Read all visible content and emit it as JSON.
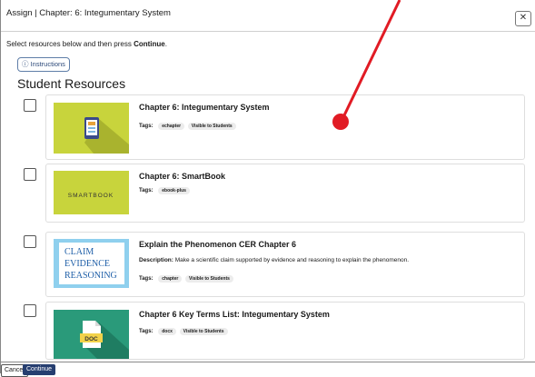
{
  "dialog": {
    "title": "Assign | Chapter: 6: Integumentary System",
    "close_icon": "close-icon"
  },
  "intro": {
    "text_before": "Select resources below and then press ",
    "text_bold": "Continue",
    "text_after": "."
  },
  "instructions_button": {
    "icon": "info-circle-icon",
    "label": "ⓘ Instructions"
  },
  "section_title": "Student Resources",
  "tags_label": "Tags:",
  "description_label": "Description:",
  "resources": [
    {
      "title": "Chapter 6: Integumentary System",
      "tags": [
        "echapter",
        "Visible to Students"
      ],
      "thumb_icon": "ebook-icon",
      "thumb_color": "#c8d43c"
    },
    {
      "title": "Chapter 6: SmartBook",
      "tags": [
        "ebook-plus"
      ],
      "thumb_text": "SMARTBOOK",
      "thumb_color": "#c8d43c"
    },
    {
      "title": "Explain the Phenomenon CER Chapter 6",
      "description": "Make a scientific claim supported by evidence and reasoning to explain the phenomenon.",
      "tags": [
        "chapter",
        "Visible to Students"
      ],
      "thumb_lines": [
        "CLAIM",
        "EVIDENCE",
        "REASONING"
      ],
      "thumb_color": "#8fd0ee"
    },
    {
      "title": "Chapter 6 Key Terms List: Integumentary System",
      "tags": [
        "docx",
        "Visible to Students"
      ],
      "thumb_icon": "doc-file-icon",
      "thumb_text": "DOC",
      "thumb_color": "#2a9a7a"
    }
  ],
  "footer": {
    "cancel_label": "Cancel",
    "continue_label": "Continue"
  },
  "colors": {
    "primary": "#263e70",
    "annotation": "#e11b24"
  }
}
